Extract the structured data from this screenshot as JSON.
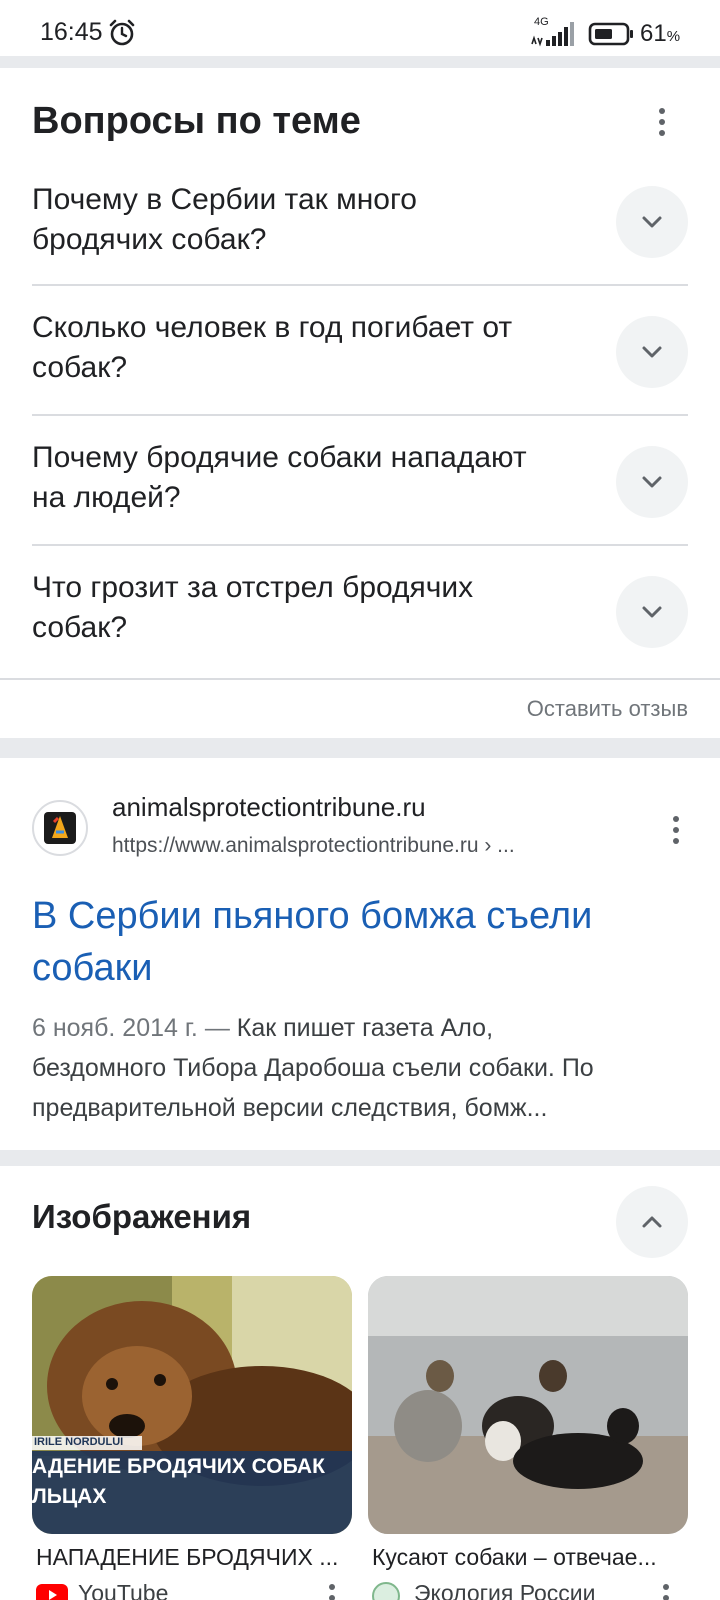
{
  "status_bar": {
    "time": "16:45",
    "network": "4G",
    "battery_percent": "61",
    "battery_unit": "%",
    "icons": [
      "alarm-icon",
      "signal-icon",
      "battery-icon"
    ]
  },
  "related_questions": {
    "title": "Вопросы по теме",
    "items": [
      {
        "line1": "Почему в Сербии так много",
        "line2": "бродячих собак?"
      },
      {
        "line1": "Сколько человек в год погибает от",
        "line2": "собак?"
      },
      {
        "line1": "Почему бродячие собаки нападают",
        "line2": "на людей?"
      },
      {
        "line1": "Что грозит за отстрел бродячих",
        "line2": "собак?"
      }
    ],
    "feedback_label": "Оставить отзыв"
  },
  "result": {
    "site_name": "animalsprotectiontribune.ru",
    "site_url": "https://www.animalsprotectiontribune.ru › ...",
    "title_line1": "В Сербии пьяного бомжа съели",
    "title_line2": "собаки",
    "snippet_date": "6 нояб. 2014 г. —",
    "snippet_line1_rest": " Как пишет газета Ало,",
    "snippet_line2": "бездомного Тибора Даробоша съели собаки. По",
    "snippet_line3": "предварительной версии следствия, бомж..."
  },
  "images": {
    "title": "Изображения",
    "cards": [
      {
        "overlay_small": "IRILE NORDULUI",
        "overlay_line1": "АДЕНИЕ БРОДЯЧИХ СОБАК",
        "overlay_line2": "ЛЬЦАХ",
        "caption": "НАПАДЕНИЕ БРОДЯЧИХ ...",
        "source": "YouTube"
      },
      {
        "caption": "Кусают собаки – отвечае...",
        "source": "Экология России"
      }
    ]
  },
  "colors": {
    "link": "#1a5fb4",
    "divider": "#e8eaed",
    "chip": "#f1f3f4"
  }
}
